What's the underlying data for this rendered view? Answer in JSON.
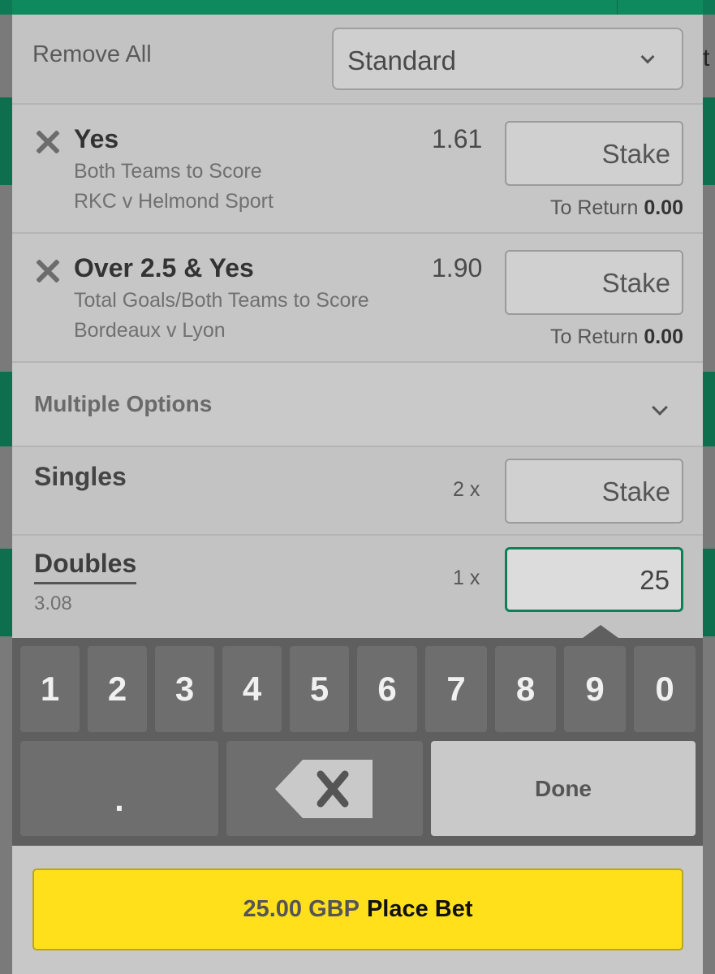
{
  "background": {
    "right_glyph": "t"
  },
  "header": {
    "remove_all": "Remove All",
    "bet_type": "Standard"
  },
  "bets": [
    {
      "selection": "Yes",
      "market": "Both Teams to Score",
      "event": "RKC v Helmond Sport",
      "odds": "1.61",
      "stake_placeholder": "Stake",
      "to_return_label": "To Return",
      "to_return_value": "0.00"
    },
    {
      "selection": "Over 2.5 & Yes",
      "market": "Total Goals/Both Teams to Score",
      "event": "Bordeaux v Lyon",
      "odds": "1.90",
      "stake_placeholder": "Stake",
      "to_return_label": "To Return",
      "to_return_value": "0.00"
    }
  ],
  "multiples": {
    "title": "Multiple Options",
    "singles": {
      "label": "Singles",
      "count": "2 x",
      "stake_placeholder": "Stake"
    },
    "doubles": {
      "label": "Doubles",
      "odds": "3.08",
      "count": "1 x",
      "stake_value": "25"
    }
  },
  "keypad": {
    "keys": [
      "1",
      "2",
      "3",
      "4",
      "5",
      "6",
      "7",
      "8",
      "9",
      "0"
    ],
    "dot": ".",
    "done": "Done"
  },
  "footer": {
    "amount": "25.00 GBP",
    "label": "Place Bet"
  },
  "colors": {
    "brand_green": "#0f8a5f",
    "place_bet_yellow": "#ffe01b",
    "keypad_bg": "#5f5f5f"
  }
}
